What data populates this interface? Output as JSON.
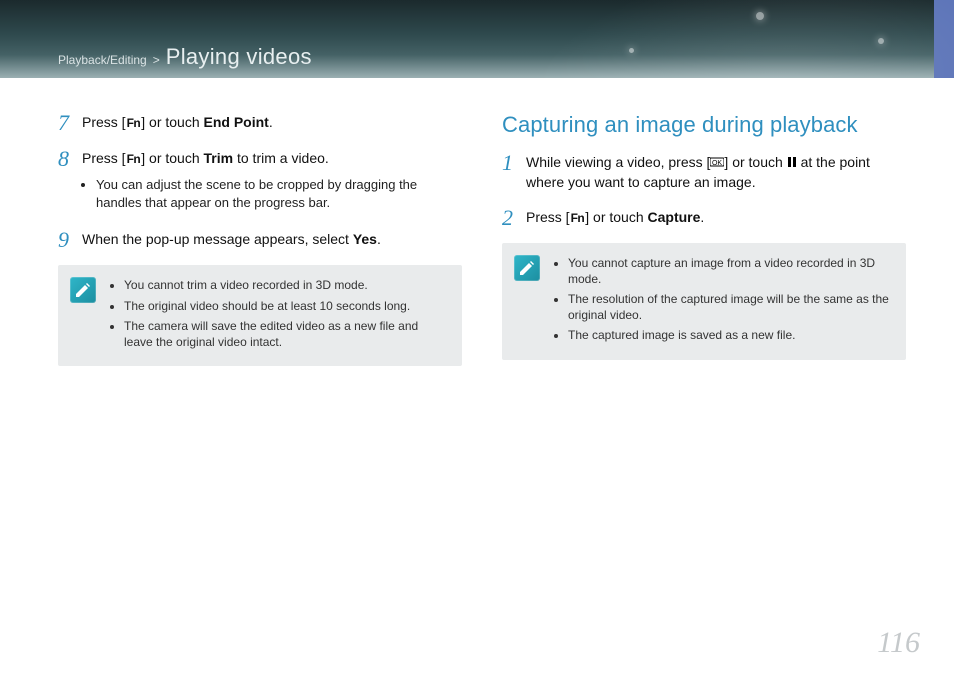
{
  "header": {
    "breadcrumb_section": "Playback/Editing",
    "separator": ">",
    "breadcrumb_title": "Playing videos"
  },
  "fn_label": "Fn",
  "left": {
    "step7_a": "Press [",
    "step7_b": "] or touch ",
    "step7_bold": "End Point",
    "step7_c": ".",
    "step8_a": "Press [",
    "step8_b": "] or touch ",
    "step8_bold": "Trim",
    "step8_c": " to trim a video.",
    "step8_sub1": "You can adjust the scene to be cropped by dragging the handles that appear on the progress bar.",
    "step9_a": "When the pop-up message appears, select ",
    "step9_bold": "Yes",
    "step9_b": ".",
    "note1": "You cannot trim a video recorded in 3D mode.",
    "note2": "The original video should be at least 10 seconds long.",
    "note3": "The camera will save the edited video as a new file and leave the original video intact."
  },
  "right": {
    "heading": "Capturing an image during playback",
    "step1_a": "While viewing a video, press [",
    "step1_b": "] or touch ",
    "step1_c": " at the point where you want to capture an image.",
    "step2_a": "Press [",
    "step2_b": "] or touch ",
    "step2_bold": "Capture",
    "step2_c": ".",
    "note1": "You cannot capture an image from a video recorded in 3D mode.",
    "note2": "The resolution of the captured image will be the same as the original video.",
    "note3": "The captured image is saved as a new file."
  },
  "nums": {
    "n7": "7",
    "n8": "8",
    "n9": "9",
    "n1": "1",
    "n2": "2"
  },
  "page_number": "116"
}
